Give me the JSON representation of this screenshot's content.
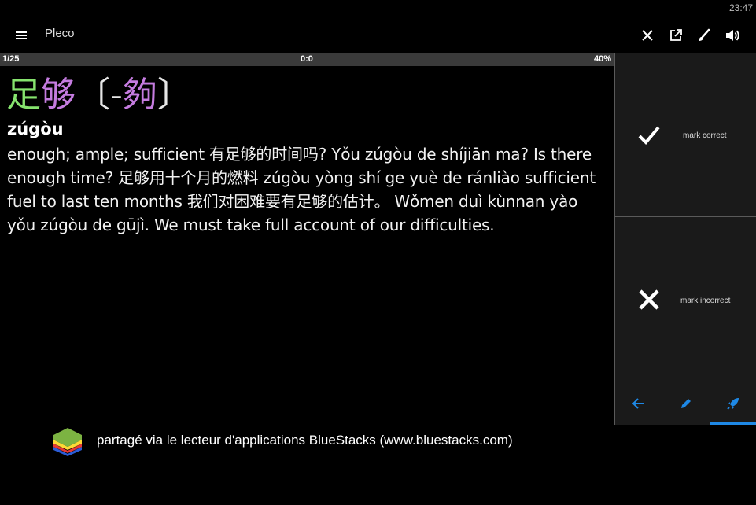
{
  "status": {
    "time": "23:47"
  },
  "appbar": {
    "title": "Pleco",
    "icons": [
      "menu-icon",
      "close-icon",
      "open-external-icon",
      "brush-icon",
      "volume-icon"
    ]
  },
  "progress": {
    "count": "1/25",
    "timer": "0:0",
    "percent": "40%"
  },
  "card": {
    "headword_simplified_1": "足",
    "headword_simplified_2": "够",
    "bracket_open": "〔",
    "variant_dash": "-",
    "variant_char": "夠",
    "bracket_close": "〕",
    "pinyin": "zúgòu",
    "definition": "enough; ample; sufficient 有足够的时间吗?   Yǒu zúgòu de shíjiān ma?   Is there enough time? 足够用十个月的燃料 zúgòu yòng shí ge yuè de ránliào sufficient fuel to last ten months 我们对困难要有足够的估计。 Wǒmen duì kùnnan yào yǒu zúgòu de gūjì. We must take full account of our difficulties.",
    "colors": {
      "tone2": "#86e36e",
      "tone4": "#c57ce0"
    }
  },
  "side": {
    "correct_label": "mark correct",
    "incorrect_label": "mark incorrect",
    "tabs": [
      "back-arrow-icon",
      "pencil-icon",
      "rocket-icon"
    ],
    "accent": "#1e88e5"
  },
  "footer": {
    "text": "partagé via le lecteur d'applications BlueStacks (www.bluestacks.com)"
  }
}
